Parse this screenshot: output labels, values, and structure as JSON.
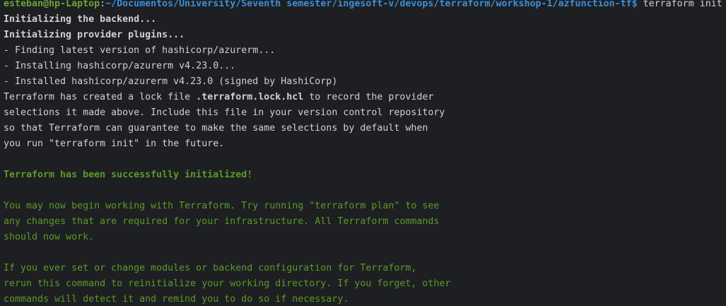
{
  "colors": {
    "background": "#1e1f22",
    "text": "#cfd1d4",
    "user": "#6aa33a",
    "path": "#3b8fd9",
    "success": "#5a9a2a"
  },
  "prompt": {
    "user_host": "esteban@hp-Laptop",
    "separator": ":",
    "cwd": "~/Documentos/University/Seventh semester/ingesoft-v/devops/terraform/workshop-1/azfunction-tf",
    "symbol": "$",
    "command": " terraform init"
  },
  "output": {
    "init_backend": "Initializing the backend...",
    "init_plugins": "Initializing provider plugins...",
    "finding": "- Finding latest version of hashicorp/azurerm...",
    "installing": "- Installing hashicorp/azurerm v4.23.0...",
    "installed": "- Installed hashicorp/azurerm v4.23.0 (signed by HashiCorp)",
    "lock_pre": "Terraform has created a lock file ",
    "lock_file": ".terraform.lock.hcl",
    "lock_post": " to record the provider",
    "lock2": "selections it made above. Include this file in your version control repository",
    "lock3": "so that Terraform can guarantee to make the same selections by default when",
    "lock4": "you run \"terraform init\" in the future.",
    "success": "Terraform has been successfully initialized!",
    "may1": "You may now begin working with Terraform. Try running \"terraform plan\" to see",
    "may2": "any changes that are required for your infrastructure. All Terraform commands",
    "may3": "should now work.",
    "if1": "If you ever set or change modules or backend configuration for Terraform,",
    "if2": "rerun this command to reinitialize your working directory. If you forget, other",
    "if3": "commands will detect it and remind you to do so if necessary."
  }
}
